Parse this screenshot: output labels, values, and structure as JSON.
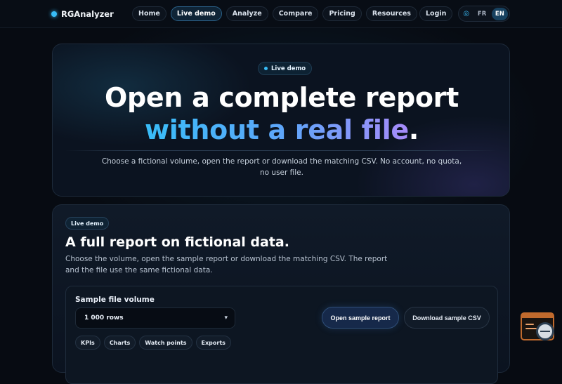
{
  "brand": {
    "name": "RGAnalyzer"
  },
  "nav": {
    "items": [
      {
        "label": "Home",
        "active": false
      },
      {
        "label": "Live demo",
        "active": true
      },
      {
        "label": "Analyze",
        "active": false
      },
      {
        "label": "Compare",
        "active": false
      },
      {
        "label": "Pricing",
        "active": false
      },
      {
        "label": "Resources",
        "active": false
      }
    ],
    "login_label": "Login",
    "languages": [
      {
        "code": "FR",
        "selected": false
      },
      {
        "code": "EN",
        "selected": true
      }
    ]
  },
  "hero": {
    "badge": "Live demo",
    "line1": "Open a complete report",
    "line2_highlight": "without a real file",
    "line2_end": ".",
    "subtitle": "Choose a fictional volume, open the report or download the matching CSV. No account, no quota, no user file."
  },
  "demo": {
    "badge": "Live demo",
    "title": "A full report on fictional data.",
    "description": "Choose the volume, open the sample report or download the matching CSV. The report and the file use the same fictional data.",
    "panel": {
      "volume_label": "Sample file volume",
      "volume_value": "1 000 rows",
      "open_button": "Open sample report",
      "download_button": "Download sample CSV",
      "chips": [
        "KPIs",
        "Charts",
        "Watch points",
        "Exports"
      ]
    }
  },
  "icons": {
    "brand": "brand-dot-icon",
    "language": "globe-icon",
    "select": "chevron-down-icon",
    "widget": "support-chat-widget-icon"
  },
  "colors": {
    "accent": "#38bdf8",
    "gradient_start": "#38bdf8",
    "gradient_end": "#a78bfa",
    "widget_orange": "#c06a2d"
  }
}
